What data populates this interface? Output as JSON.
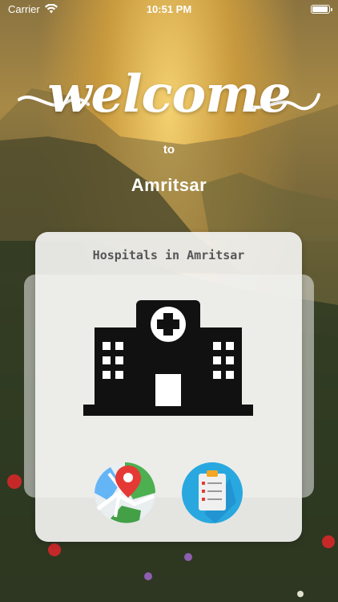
{
  "status_bar": {
    "carrier": "Carrier",
    "time": "10:51 PM",
    "icons": [
      "wifi-icon",
      "battery-icon"
    ],
    "battery_level": 0.95
  },
  "hero": {
    "welcome": "welcome",
    "to": "to",
    "city": "Amritsar"
  },
  "card": {
    "title": "Hospitals in Amritsar",
    "icons": [
      "hospital-building-icon",
      "map-pin-icon",
      "clipboard-list-icon"
    ]
  },
  "colors": {
    "map_pin": "#e53935",
    "list_bg": "#29a8e0",
    "text_white": "#ffffff"
  }
}
